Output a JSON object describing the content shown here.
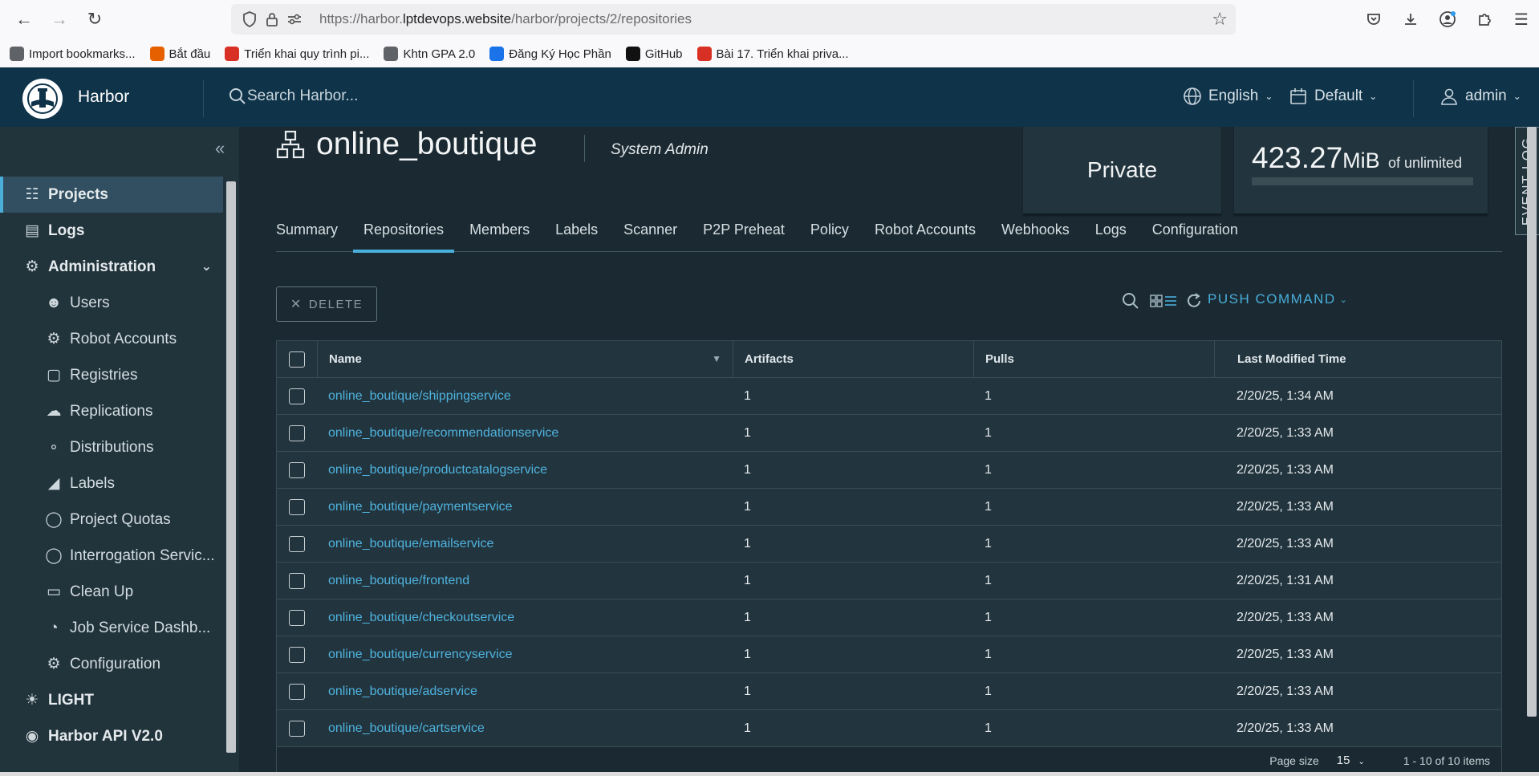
{
  "browser": {
    "url_prefix": "https://harbor.",
    "url_domain": "lptdevops.website",
    "url_path": "/harbor/projects/2/repositories",
    "bookmarks": [
      {
        "label": "Import bookmarks...",
        "color": "#5f6368",
        "icon": "import-icon"
      },
      {
        "label": "Bắt đầu",
        "color": "#e66000",
        "icon": "firefox-icon"
      },
      {
        "label": "Triển khai quy trình pi...",
        "color": "#d93025",
        "icon": "site-icon"
      },
      {
        "label": "Khtn GPA 2.0",
        "color": "#5f6368",
        "icon": "globe-icon"
      },
      {
        "label": "Đăng Ký Học Phần",
        "color": "#1a73e8",
        "icon": "site-icon"
      },
      {
        "label": "GitHub",
        "color": "#111111",
        "icon": "github-icon"
      },
      {
        "label": "Bài 17. Triển khai priva...",
        "color": "#d93025",
        "icon": "site-icon"
      }
    ]
  },
  "header": {
    "brand": "Harbor",
    "search_placeholder": "Search Harbor...",
    "language": "English",
    "theme": "Default",
    "user": "admin"
  },
  "sidebar": {
    "items": [
      {
        "label": "Projects",
        "type": "top",
        "active": true,
        "icon": "projects-icon"
      },
      {
        "label": "Logs",
        "type": "top",
        "icon": "logs-icon"
      },
      {
        "label": "Administration",
        "type": "top",
        "expandable": true,
        "icon": "admin-icon"
      },
      {
        "label": "Users",
        "type": "sub",
        "icon": "users-icon"
      },
      {
        "label": "Robot Accounts",
        "type": "sub",
        "icon": "robot-icon"
      },
      {
        "label": "Registries",
        "type": "sub",
        "icon": "registries-icon"
      },
      {
        "label": "Replications",
        "type": "sub",
        "icon": "replications-icon"
      },
      {
        "label": "Distributions",
        "type": "sub",
        "icon": "distributions-icon"
      },
      {
        "label": "Labels",
        "type": "sub",
        "icon": "labels-icon"
      },
      {
        "label": "Project Quotas",
        "type": "sub",
        "icon": "quotas-icon"
      },
      {
        "label": "Interrogation Servic...",
        "type": "sub",
        "icon": "shield-icon"
      },
      {
        "label": "Clean Up",
        "type": "sub",
        "icon": "trash-icon"
      },
      {
        "label": "Job Service Dashb...",
        "type": "sub",
        "icon": "dashboard-icon"
      },
      {
        "label": "Configuration",
        "type": "sub",
        "icon": "gear-icon"
      },
      {
        "label": "LIGHT",
        "type": "top",
        "icon": "sun-icon"
      },
      {
        "label": "Harbor API V2.0",
        "type": "top",
        "icon": "api-icon"
      }
    ]
  },
  "project": {
    "name": "online_boutique",
    "role": "System Admin",
    "access": "Private",
    "quota_value": "423.27",
    "quota_unit": "MiB",
    "quota_of": "of unlimited",
    "quota_used_fraction": 0
  },
  "tabs": [
    "Summary",
    "Repositories",
    "Members",
    "Labels",
    "Scanner",
    "P2P Preheat",
    "Policy",
    "Robot Accounts",
    "Webhooks",
    "Logs",
    "Configuration"
  ],
  "active_tab": "Repositories",
  "toolbar": {
    "delete_label": "DELETE",
    "push_label": "PUSH COMMAND"
  },
  "table": {
    "columns": [
      "Name",
      "Artifacts",
      "Pulls",
      "Last Modified Time"
    ],
    "rows": [
      {
        "name": "online_boutique/shippingservice",
        "artifacts": "1",
        "pulls": "1",
        "modified": "2/20/25, 1:34 AM"
      },
      {
        "name": "online_boutique/recommendationservice",
        "artifacts": "1",
        "pulls": "1",
        "modified": "2/20/25, 1:33 AM"
      },
      {
        "name": "online_boutique/productcatalogservice",
        "artifacts": "1",
        "pulls": "1",
        "modified": "2/20/25, 1:33 AM"
      },
      {
        "name": "online_boutique/paymentservice",
        "artifacts": "1",
        "pulls": "1",
        "modified": "2/20/25, 1:33 AM"
      },
      {
        "name": "online_boutique/emailservice",
        "artifacts": "1",
        "pulls": "1",
        "modified": "2/20/25, 1:33 AM"
      },
      {
        "name": "online_boutique/frontend",
        "artifacts": "1",
        "pulls": "1",
        "modified": "2/20/25, 1:31 AM"
      },
      {
        "name": "online_boutique/checkoutservice",
        "artifacts": "1",
        "pulls": "1",
        "modified": "2/20/25, 1:33 AM"
      },
      {
        "name": "online_boutique/currencyservice",
        "artifacts": "1",
        "pulls": "1",
        "modified": "2/20/25, 1:33 AM"
      },
      {
        "name": "online_boutique/adservice",
        "artifacts": "1",
        "pulls": "1",
        "modified": "2/20/25, 1:33 AM"
      },
      {
        "name": "online_boutique/cartservice",
        "artifacts": "1",
        "pulls": "1",
        "modified": "2/20/25, 1:33 AM"
      }
    ]
  },
  "pagination": {
    "page_size_label": "Page size",
    "page_size": "15",
    "range": "1 - 10 of 10 items"
  },
  "event_log_label": "EVENT LOG"
}
